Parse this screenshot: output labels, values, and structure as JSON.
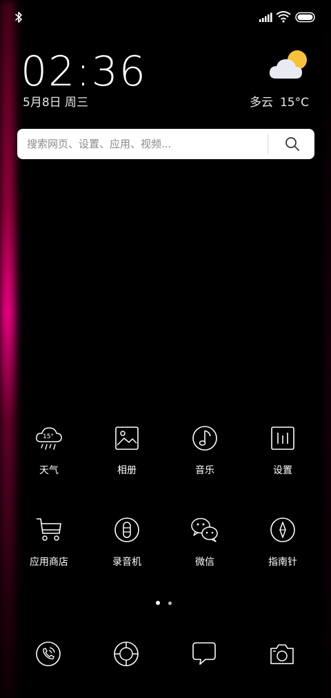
{
  "status_bar": {
    "icons": [
      "bluetooth-icon",
      "signal-icon",
      "wifi-icon",
      "battery-icon"
    ]
  },
  "clock": {
    "time": "02:36",
    "date": "5月8日 周三"
  },
  "weather": {
    "condition": "多云",
    "temperature": "15°C",
    "icon": "partly-cloudy-icon"
  },
  "search": {
    "placeholder": "搜索网页、设置、应用、视频...",
    "icon": "search-icon"
  },
  "apps": [
    {
      "label": "天气",
      "icon": "weather-icon",
      "badge_text": "15°"
    },
    {
      "label": "相册",
      "icon": "gallery-icon"
    },
    {
      "label": "音乐",
      "icon": "music-icon"
    },
    {
      "label": "设置",
      "icon": "settings-icon"
    },
    {
      "label": "应用商店",
      "icon": "app-store-icon"
    },
    {
      "label": "录音机",
      "icon": "recorder-icon"
    },
    {
      "label": "微信",
      "icon": "wechat-icon"
    },
    {
      "label": "指南针",
      "icon": "compass-icon"
    }
  ],
  "page_indicator": {
    "pages": 2,
    "current": 1
  },
  "dock": [
    {
      "icon": "phone-icon"
    },
    {
      "icon": "browser-icon"
    },
    {
      "icon": "messages-icon"
    },
    {
      "icon": "camera-icon"
    }
  ],
  "colors": {
    "background": "#000000",
    "edge_glow": "#ff0090",
    "sun": "#f7c23a",
    "search_bg": "#ffffff"
  }
}
